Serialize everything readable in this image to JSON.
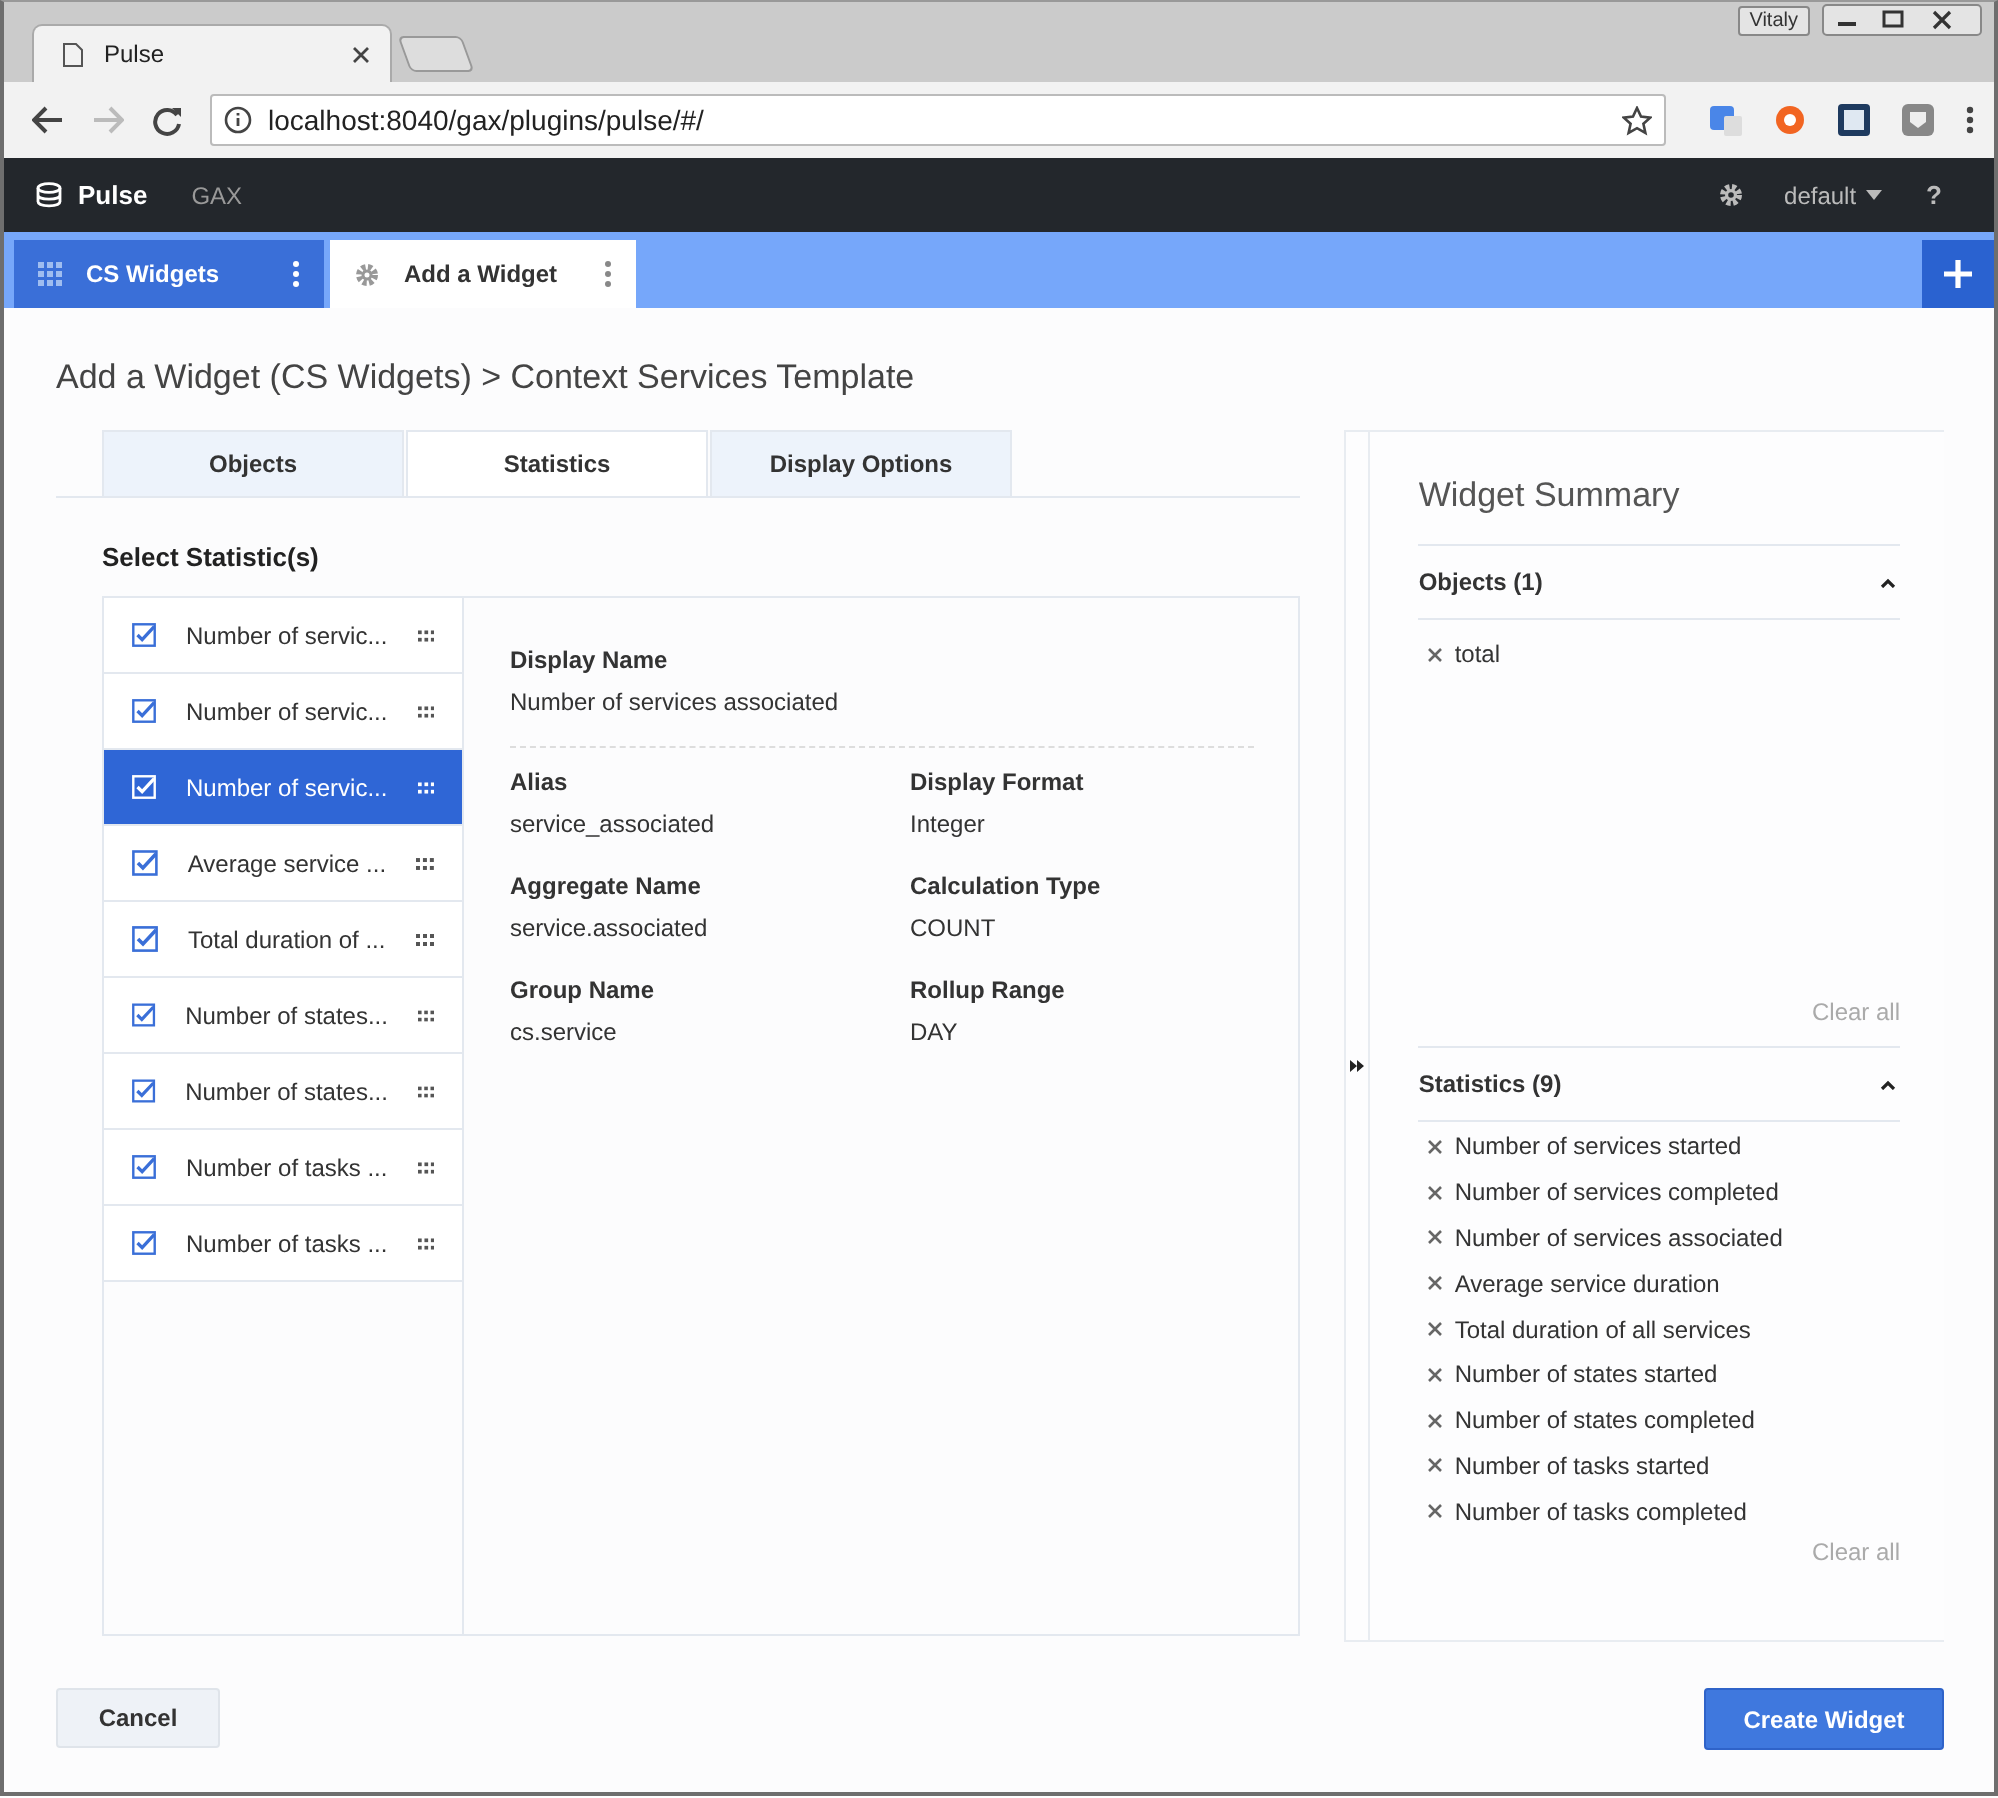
{
  "window": {
    "user": "Vitaly"
  },
  "browser_tabs": [
    {
      "title": "Pulse"
    }
  ],
  "address_bar": {
    "url": "localhost:8040/gax/plugins/pulse/#/"
  },
  "app_bar": {
    "brand": "Pulse",
    "links": [
      "GAX"
    ],
    "profile": "default",
    "help": "?"
  },
  "widget_tabs": [
    {
      "label": "CS Widgets",
      "kind": "grid",
      "selected": true
    },
    {
      "label": "Add a Widget",
      "kind": "gear",
      "selected": false
    }
  ],
  "page_title": "Add a Widget (CS Widgets) > Context Services Template",
  "step_tabs": [
    {
      "label": "Objects",
      "selected": false
    },
    {
      "label": "Statistics",
      "selected": true
    },
    {
      "label": "Display Options",
      "selected": false
    }
  ],
  "section_title": "Select Statistic(s)",
  "statistics": [
    {
      "label": "Number of servic...",
      "checked": true,
      "selected": false
    },
    {
      "label": "Number of servic...",
      "checked": true,
      "selected": false
    },
    {
      "label": "Number of servic...",
      "checked": true,
      "selected": true
    },
    {
      "label": "Average service ...",
      "checked": true,
      "selected": false
    },
    {
      "label": "Total duration of ...",
      "checked": true,
      "selected": false
    },
    {
      "label": "Number of states...",
      "checked": true,
      "selected": false
    },
    {
      "label": "Number of states...",
      "checked": true,
      "selected": false
    },
    {
      "label": "Number of tasks ...",
      "checked": true,
      "selected": false
    },
    {
      "label": "Number of tasks ...",
      "checked": true,
      "selected": false
    }
  ],
  "details": {
    "display_name": {
      "label": "Display Name",
      "value": "Number of services associated"
    },
    "fields": [
      {
        "label": "Alias",
        "value": "service_associated"
      },
      {
        "label": "Display Format",
        "value": "Integer"
      },
      {
        "label": "Aggregate Name",
        "value": "service.associated"
      },
      {
        "label": "Calculation Type",
        "value": "COUNT"
      },
      {
        "label": "Group Name",
        "value": "cs.service"
      },
      {
        "label": "Rollup Range",
        "value": "DAY"
      }
    ]
  },
  "summary": {
    "title": "Widget Summary",
    "sections": [
      {
        "title": "Objects (1)",
        "expanded": true,
        "items": [
          "total"
        ],
        "clear": "Clear all"
      },
      {
        "title": "Statistics (9)",
        "expanded": true,
        "items": [
          "Number of services started",
          "Number of services completed",
          "Number of services associated",
          "Average service duration",
          "Total duration of all services",
          "Number of states started",
          "Number of states completed",
          "Number of tasks started",
          "Number of tasks completed"
        ],
        "clear": "Clear all"
      }
    ]
  },
  "buttons": {
    "cancel": "Cancel",
    "create": "Create Widget"
  }
}
